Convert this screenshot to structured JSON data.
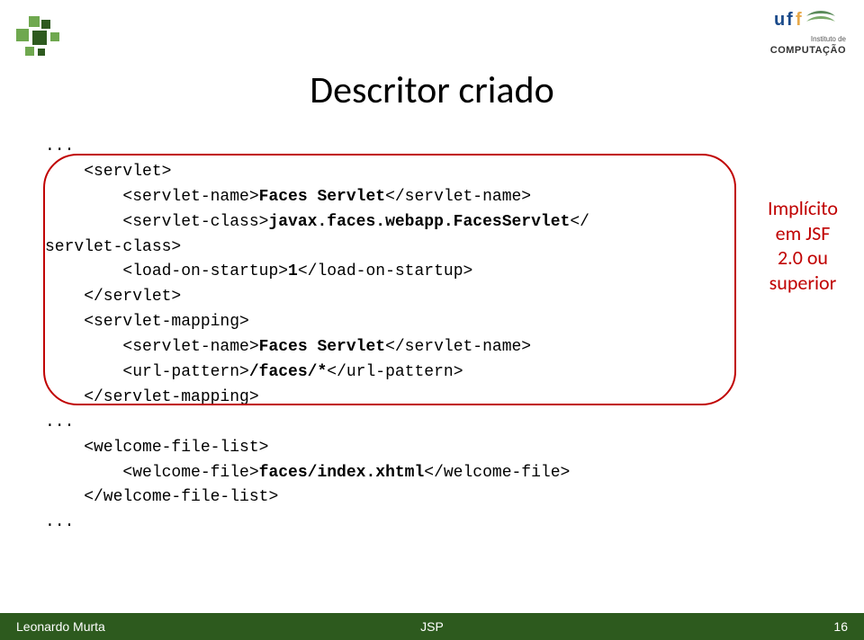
{
  "title": "Descritor criado",
  "code": {
    "l1": "...",
    "l2": "    <servlet>",
    "l3a": "        <servlet-name>",
    "l3b": "Faces Servlet",
    "l3c": "</servlet-name>",
    "l4a": "        <servlet-class>",
    "l4b": "javax.faces.webapp.FacesServlet",
    "l4c": "</",
    "l5": "servlet-class>",
    "l6a": "        <load-on-startup>",
    "l6b": "1",
    "l6c": "</load-on-startup>",
    "l7": "    </servlet>",
    "l8": "    <servlet-mapping>",
    "l9a": "        <servlet-name>",
    "l9b": "Faces Servlet",
    "l9c": "</servlet-name>",
    "l10a": "        <url-pattern>",
    "l10b": "/faces/*",
    "l10c": "</url-pattern>",
    "l11": "    </servlet-mapping>",
    "l12": "...",
    "l13": "    <welcome-file-list>",
    "l14a": "        <welcome-file>",
    "l14b": "faces/index.xhtml",
    "l14c": "</welcome-file>",
    "l15": "    </welcome-file-list>",
    "l16": "..."
  },
  "annotation": {
    "line1": "Implícito",
    "line2": "em JSF",
    "line3": "2.0 ou",
    "line4": "superior"
  },
  "logo": {
    "instituto": "Instituto de",
    "computacao": "COMPUTAÇÃO"
  },
  "footer": {
    "author": "Leonardo Murta",
    "center": "JSP",
    "page": "16"
  }
}
